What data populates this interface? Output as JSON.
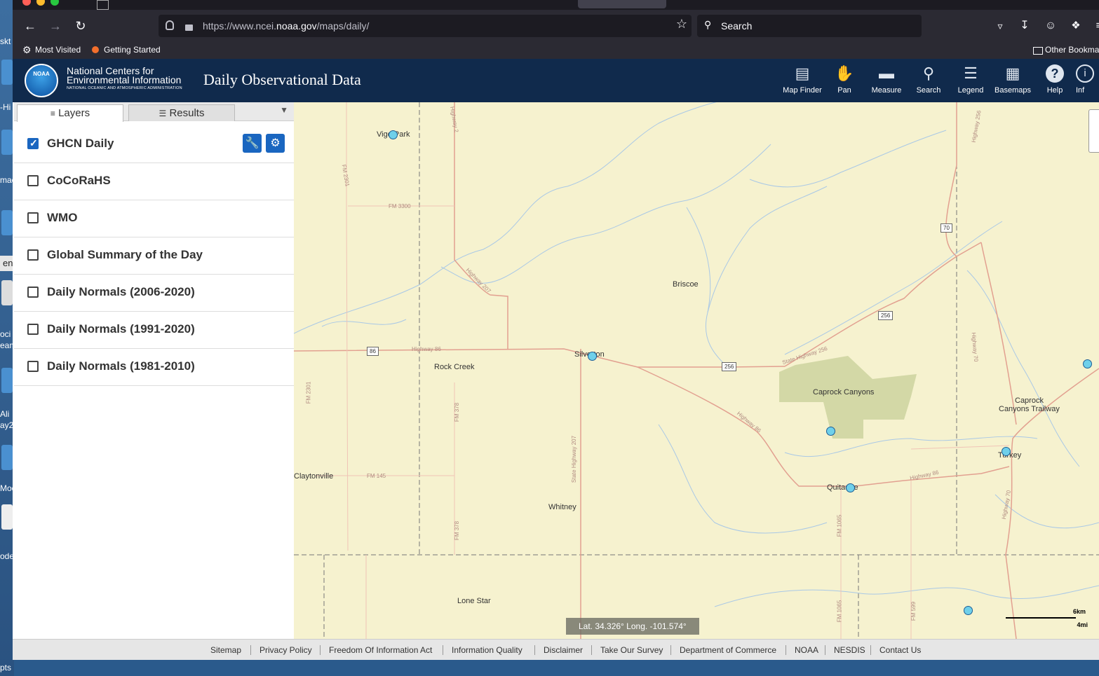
{
  "desktop": {
    "labels": [
      "skt",
      "-Hi",
      "mac",
      "oci",
      "eam",
      "Ali",
      "ay2",
      "Moc",
      "ode",
      "pts"
    ],
    "tooltip": "enshot"
  },
  "browser": {
    "url_prefix": "https://www.ncei.",
    "url_domain": "noaa.gov",
    "url_suffix": "/maps/daily/",
    "search_placeholder": "Search",
    "bookmarks": [
      "Most Visited",
      "Getting Started",
      "Other Bookmarks"
    ]
  },
  "header": {
    "logo_text": "NOAA",
    "org_line1": "National Centers for",
    "org_line2": "Environmental Information",
    "org_sub": "NATIONAL OCEANIC AND ATMOSPHERIC ADMINISTRATION",
    "title": "Daily Observational Data",
    "tools": [
      {
        "label": "Map Finder",
        "icon": "map-finder-icon"
      },
      {
        "label": "Pan",
        "icon": "hand-icon"
      },
      {
        "label": "Measure",
        "icon": "ruler-icon"
      },
      {
        "label": "Search",
        "icon": "search-icon"
      },
      {
        "label": "Legend",
        "icon": "list-icon"
      },
      {
        "label": "Basemaps",
        "icon": "basemaps-icon"
      },
      {
        "label": "Help",
        "icon": "help-icon"
      },
      {
        "label": "Inf",
        "icon": "info-icon"
      }
    ]
  },
  "sidebar": {
    "tabs": [
      {
        "label": "Layers",
        "icon": "layers-icon"
      },
      {
        "label": "Results",
        "icon": "list-icon"
      }
    ],
    "layers": [
      {
        "name": "GHCN Daily",
        "checked": true
      },
      {
        "name": "CoCoRaHS",
        "checked": false
      },
      {
        "name": "WMO",
        "checked": false
      },
      {
        "name": "Global Summary of the Day",
        "checked": false
      },
      {
        "name": "Daily Normals (2006-2020)",
        "checked": false
      },
      {
        "name": "Daily Normals (1991-2020)",
        "checked": false
      },
      {
        "name": "Daily Normals (1981-2010)",
        "checked": false
      }
    ]
  },
  "map": {
    "places": [
      "Vigo Park",
      "Briscoe",
      "Rock Creek",
      "Silverton",
      "Caprock Canyons",
      "Caprock",
      "Canyons Trailway",
      "Turkey",
      "Claytonville",
      "Whitney",
      "Quitaque",
      "Lone Star"
    ],
    "shields": [
      "86",
      "256",
      "256",
      "70"
    ],
    "road_labels": [
      "FM 3300",
      "FM 2301",
      "Highway 207",
      "Highway 86",
      "Highway 86",
      "Highway 86",
      "FM 2301",
      "FM 378",
      "State Highway 207",
      "FM 145",
      "FM 378",
      "FM 1065",
      "FM 1065",
      "FM 599",
      "Highway 70",
      "Highway 70",
      "State Highway 256",
      "Highway 256",
      "Highway 2"
    ],
    "latlong": "Lat. 34.326°  Long. -101.574°",
    "scale_km": "6km",
    "scale_mi": "4mi"
  },
  "footer": {
    "links": [
      "Sitemap",
      "Privacy Policy",
      "Freedom Of Information Act",
      "Information Quality",
      "Disclaimer",
      "Take Our Survey",
      "Department of Commerce",
      "NOAA",
      "NESDIS",
      "Contact Us"
    ]
  }
}
